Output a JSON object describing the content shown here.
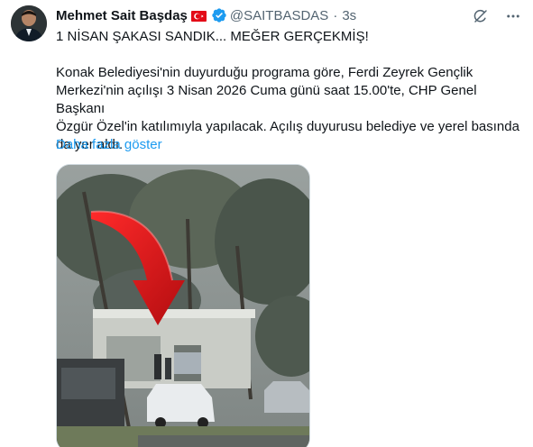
{
  "author": {
    "display_name": "Mehmet Sait Başdaş",
    "flag_icon": "turkey-flag-icon",
    "verified_icon": "verified-badge-icon",
    "handle": "@SAITBASDAS",
    "separator": "·",
    "timestamp": "3s"
  },
  "header_actions": {
    "grok_icon": "grok-icon",
    "more_icon": "more-icon"
  },
  "tweet": {
    "title": "1 NİSAN ŞAKASI SANDIK... MEĞER GERÇEKMİŞ!",
    "body_line_1": "Konak Belediyesi'nin duyurduğu programa göre, Ferdi Zeyrek Gençlik",
    "body_line_2": "Merkezi'nin açılışı 3 Nisan 2026 Cuma günü saat 15.00'te, CHP Genel Başkanı",
    "body_line_3": "Özgür Özel'in katılımıyla yapılacak. Açılış duyurusu belediye ve yerel basında",
    "body_line_4": "da yer aldı.",
    "show_more": "Daha fazla göster"
  },
  "colors": {
    "link": "#1d9bf0",
    "secondary_text": "#536471",
    "verified": "#1d9bf0",
    "arrow": "#e0161a"
  }
}
